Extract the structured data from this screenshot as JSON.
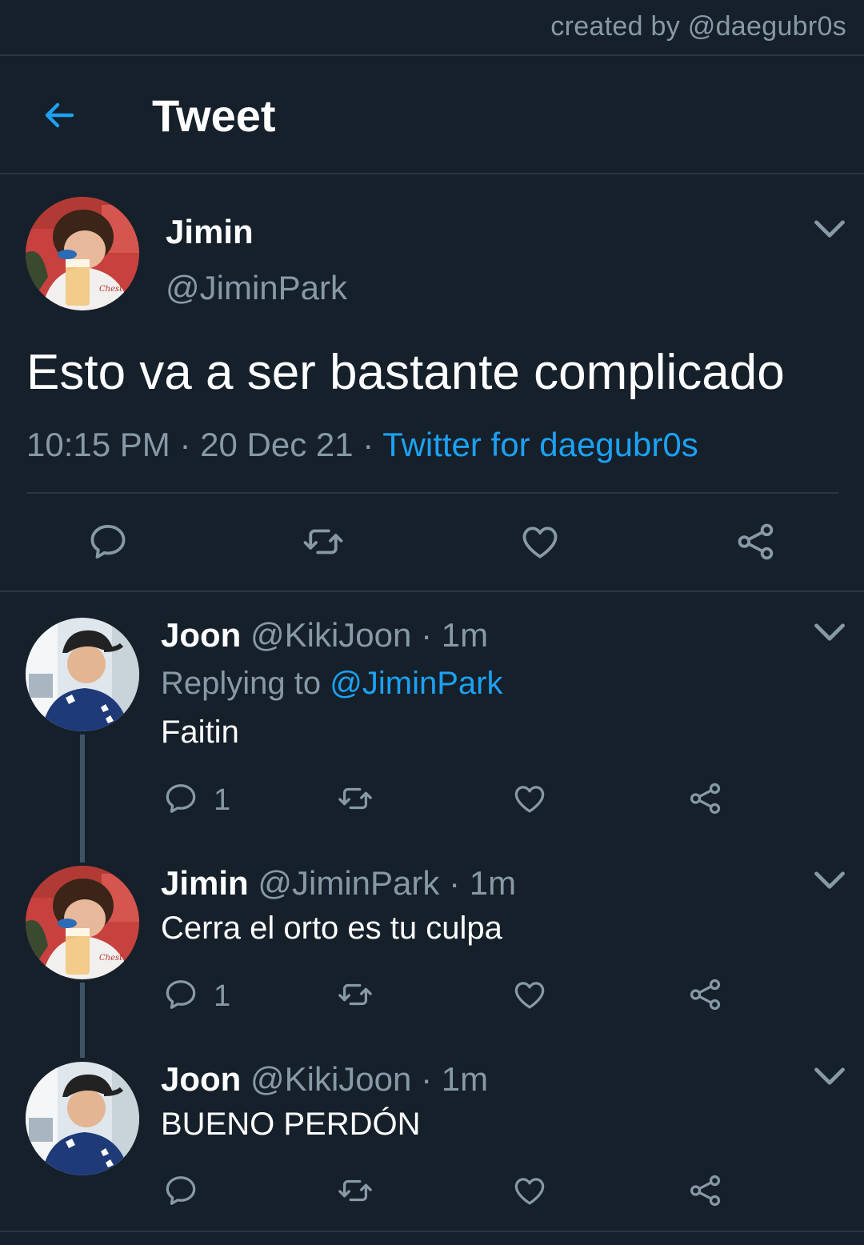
{
  "credit": "created by @daegubr0s",
  "header": {
    "title": "Tweet"
  },
  "main_tweet": {
    "name": "Jimin",
    "handle": "@JiminPark",
    "text": "Esto va a ser bastante complicado",
    "time": "10:15 PM",
    "date": "20 Dec 21",
    "source": "Twitter for daegubr0s",
    "sep": "·"
  },
  "replies": [
    {
      "name": "Joon",
      "handle": "@KikiJoon",
      "time": "1m",
      "replying_prefix": "Replying to",
      "replying_to": "@JiminPark",
      "text": "Faitin",
      "reply_count": "1"
    },
    {
      "name": "Jimin",
      "handle": "@JiminPark",
      "time": "1m",
      "text": "Cerra el orto es tu culpa",
      "reply_count": "1"
    },
    {
      "name": "Joon",
      "handle": "@KikiJoon",
      "time": "1m",
      "text": "BUENO PERDÓN",
      "reply_count": ""
    }
  ],
  "colors": {
    "background": "#15202b",
    "accent": "#1da1f2",
    "muted": "#8899a6",
    "divider": "#2a3640",
    "thread_line": "#3d5466"
  }
}
